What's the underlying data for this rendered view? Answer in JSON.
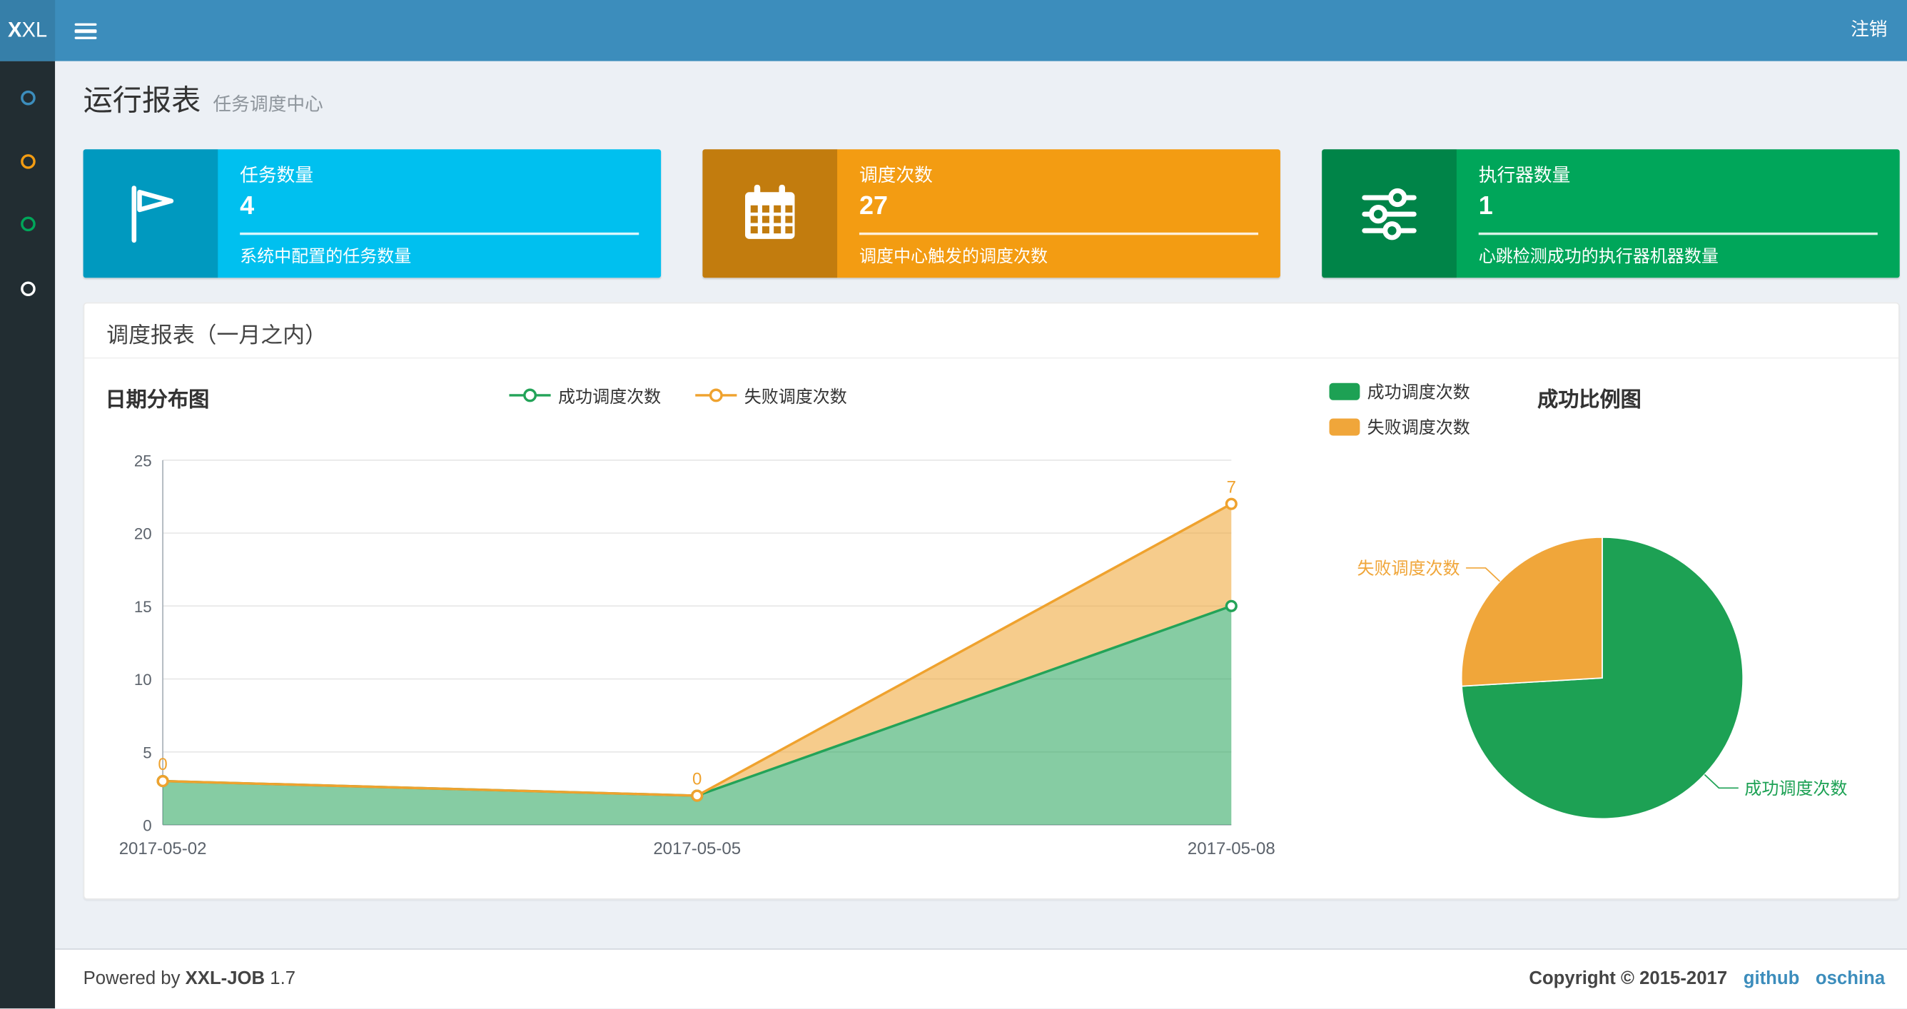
{
  "navbar": {
    "logo_bold": "X",
    "logo_light": "XL",
    "logout": "注销",
    "bg": "#3c8dbc",
    "logo_bg": "#367fa9"
  },
  "sidebar": {
    "bg": "#222d32",
    "items": [
      {
        "label": "menu-item-1",
        "color": "#3c8dbc"
      },
      {
        "label": "menu-item-2",
        "color": "#f39c12"
      },
      {
        "label": "menu-item-3",
        "color": "#00a65a"
      },
      {
        "label": "menu-item-4",
        "color": "#ffffff"
      }
    ]
  },
  "page_header": {
    "title": "运行报表",
    "subtitle": "任务调度中心"
  },
  "info_boxes": [
    {
      "title": "任务数量",
      "value": "4",
      "desc": "系统中配置的任务数量",
      "color": "#00c0ef",
      "icon": "flag-icon"
    },
    {
      "title": "调度次数",
      "value": "27",
      "desc": "调度中心触发的调度次数",
      "color": "#f39c12",
      "icon": "calendar-icon"
    },
    {
      "title": "执行器数量",
      "value": "1",
      "desc": "心跳检测成功的执行器机器数量",
      "color": "#00a65a",
      "icon": "sliders-icon"
    }
  ],
  "panel": {
    "title": "调度报表（一月之内）"
  },
  "chart_data": [
    {
      "type": "area",
      "title": "日期分布图",
      "stacked": true,
      "x": [
        "2017-05-02",
        "2017-05-05",
        "2017-05-08"
      ],
      "series": [
        {
          "name": "成功调度次数",
          "values": [
            3,
            2,
            15
          ],
          "color": "#23a358"
        },
        {
          "name": "失败调度次数",
          "values": [
            0,
            0,
            7
          ],
          "color": "#efa22e"
        }
      ],
      "ylim": [
        0,
        25
      ],
      "yticks": [
        0,
        5,
        10,
        15,
        20,
        25
      ],
      "grid": true,
      "legend_position": "top",
      "data_labels_series": 1
    },
    {
      "type": "pie",
      "title": "成功比例图",
      "legend_position": "left",
      "slices": [
        {
          "name": "成功调度次数",
          "value": 20,
          "color": "#1da154"
        },
        {
          "name": "失败调度次数",
          "value": 7,
          "color": "#f0a63a"
        }
      ]
    }
  ],
  "footer": {
    "powered_prefix": "Powered by",
    "product": "XXL-JOB",
    "version": "1.7",
    "copyright": "Copyright © 2015-2017",
    "links": [
      {
        "label": "github"
      },
      {
        "label": "oschina"
      }
    ],
    "link_color": "#3c8dbc"
  }
}
